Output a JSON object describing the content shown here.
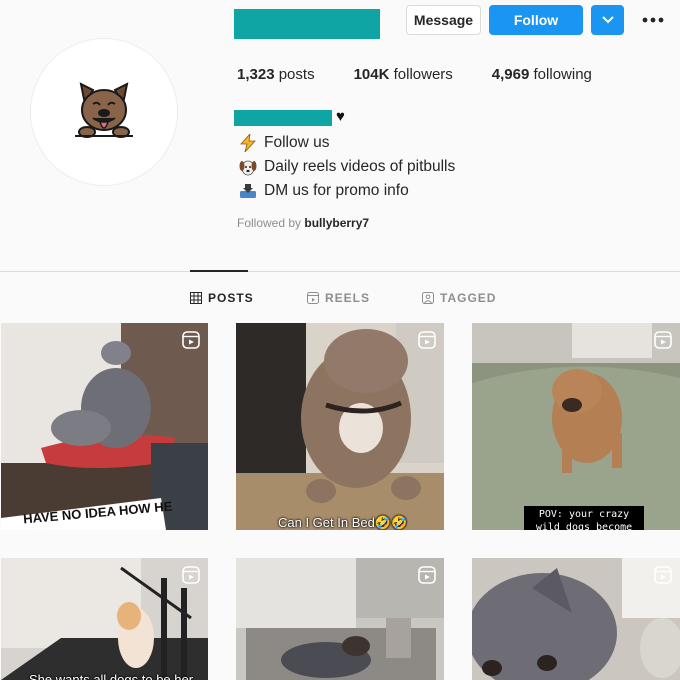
{
  "colors": {
    "accent": "#1b95f2",
    "redact": "#10a5a5"
  },
  "profile": {
    "stats": [
      {
        "value": "1,323",
        "label": "posts"
      },
      {
        "value": "104K",
        "label": "followers"
      },
      {
        "value": "4,969",
        "label": "following"
      }
    ],
    "bio": [
      {
        "icon": "lightning-icon",
        "text": "Follow us"
      },
      {
        "icon": "dog-face-icon",
        "text": "Daily reels videos of pitbulls"
      },
      {
        "icon": "inbox-tray-icon",
        "text": "DM us for promo info"
      }
    ],
    "followed_by_prefix": "Followed by",
    "followed_by_user": "bullyberry7"
  },
  "buttons": {
    "message": "Message",
    "follow": "Follow"
  },
  "tabs": [
    {
      "label": "POSTS",
      "icon": "grid-icon",
      "active": true
    },
    {
      "label": "REELS",
      "icon": "reels-icon",
      "active": false
    },
    {
      "label": "TAGGED",
      "icon": "tagged-icon",
      "active": false
    }
  ],
  "posts": [
    {
      "caption": "HAVE NO IDEA HOW HE"
    },
    {
      "caption": "Can I Get In Bed🤣🤣"
    },
    {
      "caption": "POV: your crazy wild dogs become so"
    },
    {
      "caption": "She wants all dogs to be her"
    },
    {
      "caption": ""
    },
    {
      "caption": ""
    }
  ]
}
